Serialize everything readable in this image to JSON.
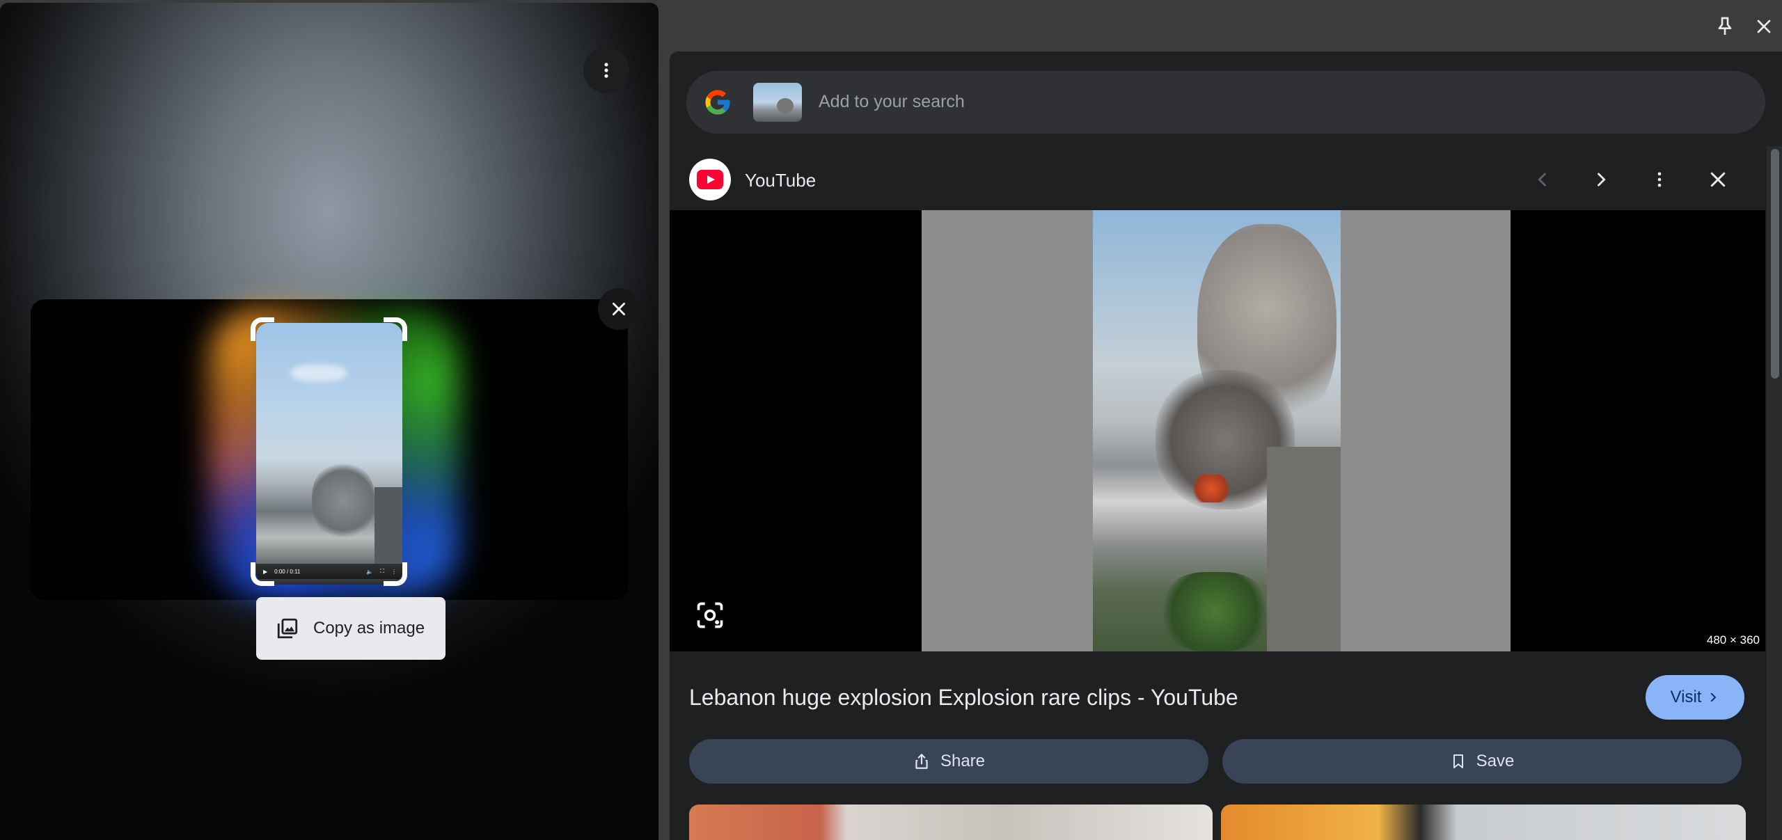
{
  "overlay": {
    "copy_label": "Copy as image",
    "player_time": "0:00 / 0:11"
  },
  "search": {
    "placeholder": "Add to your search"
  },
  "result": {
    "source": "YouTube",
    "title": "Lebanon huge explosion Explosion rare clips - YouTube",
    "dimensions": "480 × 360",
    "visit_label": "Visit",
    "share_label": "Share",
    "save_label": "Save"
  },
  "colors": {
    "accent": "#8ab4f8",
    "action_bg": "#394457",
    "panel_bg": "#1f2022"
  }
}
